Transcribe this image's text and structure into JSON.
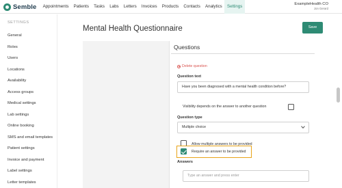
{
  "brand": {
    "name": "Semble"
  },
  "nav": {
    "items": [
      "Appointments",
      "Patients",
      "Tasks",
      "Labs",
      "Letters",
      "Invoices",
      "Products",
      "Contacts",
      "Analytics",
      "Settings"
    ],
    "active": "Settings"
  },
  "account": {
    "org": "ExampleHealth CO",
    "user": "Jon Gerard"
  },
  "sidebar": {
    "heading": "SETTINGS",
    "items": [
      "General",
      "Roles",
      "Users",
      "Locations",
      "Availability",
      "Access groups",
      "Medical settings",
      "Lab settings",
      "Online booking",
      "SMS and email templates",
      "Patient settings",
      "Invoice and payment",
      "Label settings",
      "Letter templates"
    ]
  },
  "page": {
    "title": "Mental Health Questionnaire",
    "save_label": "Save"
  },
  "questions": {
    "title": "Questions",
    "delete_label": "Delete question",
    "question_text_label": "Question text",
    "question_text_value": "Have you been diagnosed with a mental health condition before?",
    "visibility_label": "Visibility depends on the answer to another question",
    "visibility_checked": false,
    "question_type_label": "Question type",
    "question_type_value": "Multiple choice",
    "allow_multiple_label": "Allow multiple answers to be provided",
    "allow_multiple_checked": false,
    "require_answer_label": "Require an answer to be provided",
    "require_answer_checked": true,
    "answers_label": "Answers",
    "answers_placeholder": "Type an answer and press enter"
  },
  "colors": {
    "accent": "#2e8b74",
    "danger": "#d9534f",
    "highlight": "#e8a317"
  }
}
